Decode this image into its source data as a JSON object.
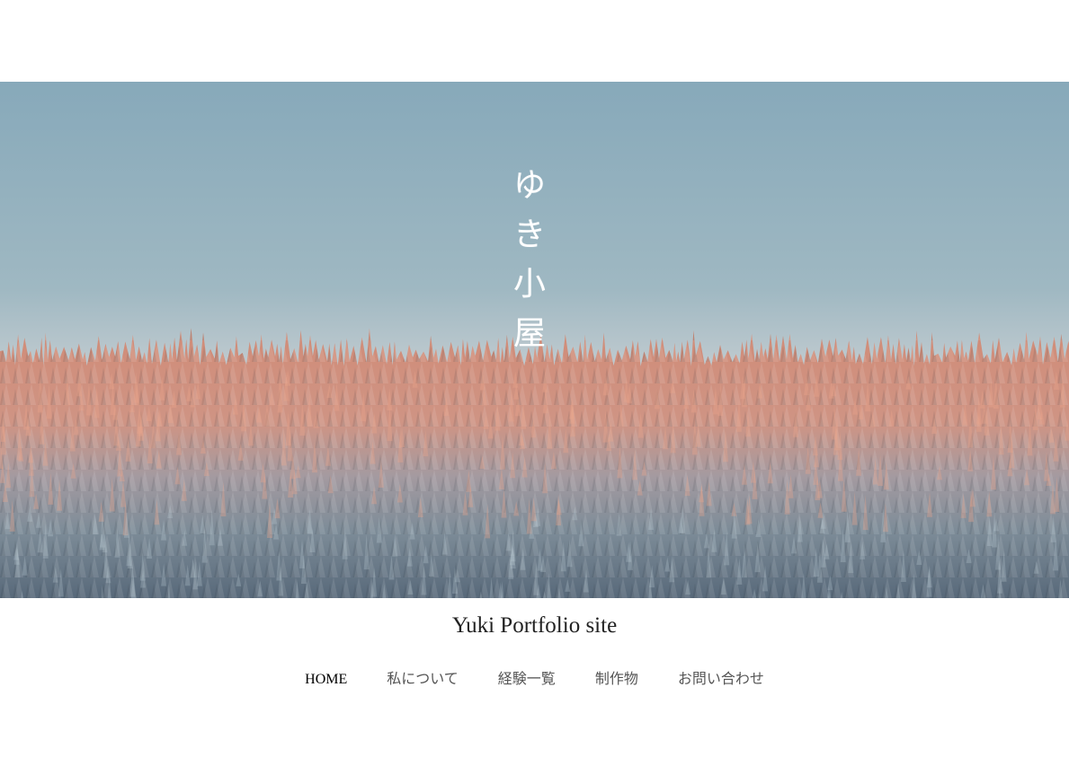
{
  "hero": {
    "title": "ゆき小屋",
    "image": "snow-covered-forest-at-sunrise"
  },
  "site_name": "Yuki Portfolio site",
  "nav": {
    "items": [
      {
        "label": "HOME",
        "active": true
      },
      {
        "label": "私について",
        "active": false
      },
      {
        "label": "経験一覧",
        "active": false
      },
      {
        "label": "制作物",
        "active": false
      },
      {
        "label": "お問い合わせ",
        "active": false
      }
    ]
  },
  "colors": {
    "sky_top": "#87a9ba",
    "sky_bottom": "#c7cfd2",
    "forest_lit": "#d9917a",
    "forest_shadow": "#6d7f8c",
    "text": "#222222"
  }
}
